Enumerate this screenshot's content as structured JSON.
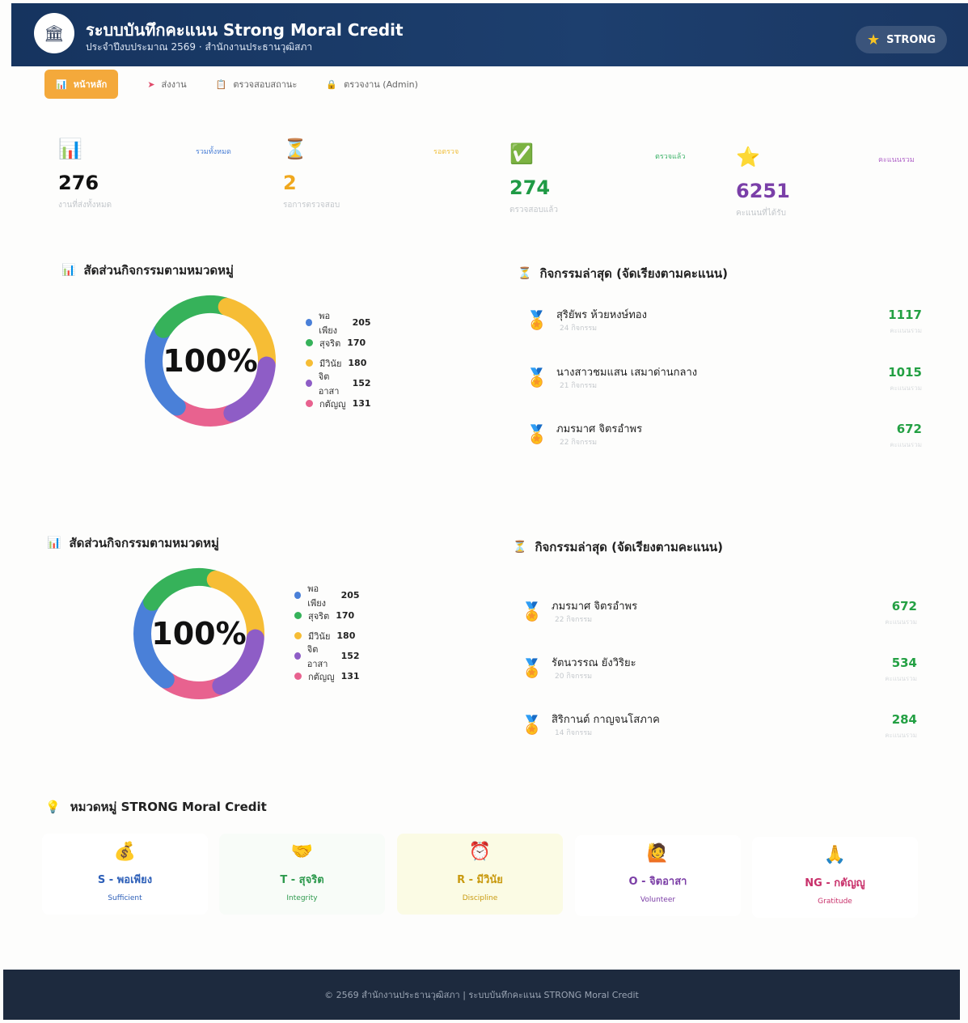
{
  "header": {
    "title": "ระบบบันทึกคะแนน Strong Moral Credit",
    "subtitle": "ประจำปีงบประมาณ 2569 · สำนักงานประธานวุฒิสภา",
    "logo_icon": "building-icon",
    "badge_label": "STRONG"
  },
  "nav": {
    "items": [
      {
        "label": "หน้าหลัก",
        "icon": "chart-icon"
      },
      {
        "label": "ส่งงาน",
        "icon": "send-icon"
      },
      {
        "label": "ตรวจสอบสถานะ",
        "icon": "clipboard-icon"
      },
      {
        "label": "ตรวจงาน (Admin)",
        "icon": "lock-icon"
      }
    ]
  },
  "stats": [
    {
      "icon": "bar-chart-icon",
      "tag": "รวมทั้งหมด",
      "value": "276",
      "label": "งานที่ส่งทั้งหมด",
      "color": "#111111",
      "tag_color": "#4a7fd6"
    },
    {
      "icon": "hourglass-icon",
      "tag": "รอตรวจ",
      "value": "2",
      "label": "รอการตรวจสอบ",
      "color": "#f0a81e",
      "tag_color": "#f0c040"
    },
    {
      "icon": "check-icon",
      "tag": "ตรวจแล้ว",
      "value": "274",
      "label": "ตรวจสอบแล้ว",
      "color": "#1f9a45",
      "tag_color": "#3eb36a"
    },
    {
      "icon": "star-icon",
      "tag": "คะแนนรวม",
      "value": "6251",
      "label": "คะแนนที่ได้รับ",
      "color": "#7a3fa8",
      "tag_color": "#b064c8"
    }
  ],
  "chart_panels": [
    {
      "title": "สัดส่วนกิจกรรมตามหมวดหมู่",
      "center_label": "100%"
    },
    {
      "title": "สัดส่วนกิจกรรมตามหมวดหมู่",
      "center_label": "100%"
    }
  ],
  "chart_data": [
    {
      "type": "pie",
      "categories": [
        "พอเพียง",
        "สุจริต",
        "มีวินัย",
        "จิตอาสา",
        "กตัญญู"
      ],
      "values": [
        205,
        170,
        180,
        152,
        131
      ],
      "colors": [
        "#4a80d8",
        "#36b25a",
        "#f6bd35",
        "#8e5dc6",
        "#e8628f"
      ],
      "title": "สัดส่วนกิจกรรมตามหมวดหมู่"
    },
    {
      "type": "pie",
      "categories": [
        "พอเพียง",
        "สุจริต",
        "มีวินัย",
        "จิตอาสา",
        "กตัญญู"
      ],
      "values": [
        205,
        170,
        180,
        152,
        131
      ],
      "colors": [
        "#4a80d8",
        "#36b25a",
        "#f6bd35",
        "#8e5dc6",
        "#e8628f"
      ],
      "title": "สัดส่วนกิจกรรมตามหมวดหมู่"
    }
  ],
  "ranking_panels": [
    {
      "title": "กิจกรรมล่าสุด (จัดเรียงตามคะแนน)",
      "items": [
        {
          "name": "สุริยัพร ห้วยหงษ์ทอง",
          "count": "24 กิจกรรม",
          "score": "1117",
          "score_label": "คะแนนรวม"
        },
        {
          "name": "นางสาวชมแสน เสมาด่านกลาง",
          "count": "21 กิจกรรม",
          "score": "1015",
          "score_label": "คะแนนรวม"
        },
        {
          "name": "ภมรมาศ จิตรอำพร",
          "count": "22 กิจกรรม",
          "score": "672",
          "score_label": "คะแนนรวม"
        }
      ]
    },
    {
      "title": "กิจกรรมล่าสุด (จัดเรียงตามคะแนน)",
      "items": [
        {
          "name": "ภมรมาศ จิตรอำพร",
          "count": "22 กิจกรรม",
          "score": "672",
          "score_label": "คะแนนรวม"
        },
        {
          "name": "รัตนวรรณ ยังวิริยะ",
          "count": "20 กิจกรรม",
          "score": "534",
          "score_label": "คะแนนรวม"
        },
        {
          "name": "สิริกานต์ กาญจนโสภาค",
          "count": "14 กิจกรรม",
          "score": "284",
          "score_label": "คะแนนรวม"
        }
      ]
    }
  ],
  "categories": {
    "title": "หมวดหมู่ STRONG Moral Credit",
    "items": [
      {
        "name": "S - พอเพียง",
        "en": "Sufficient",
        "icon": "money-bag-icon",
        "color": "#2d5fb8",
        "bg": "#ffffff"
      },
      {
        "name": "T - สุจริต",
        "en": "Integrity",
        "icon": "handshake-icon",
        "color": "#2e9a4e",
        "bg": "#f8fcf8"
      },
      {
        "name": "R - มีวินัย",
        "en": "Discipline",
        "icon": "alarm-clock-icon",
        "color": "#c99a10",
        "bg": "#fbfbe4"
      },
      {
        "name": "O - จิตอาสา",
        "en": "Volunteer",
        "icon": "raised-hand-icon",
        "color": "#7b3ea6",
        "bg": "#ffffff"
      },
      {
        "name": "NG - กตัญญู",
        "en": "Gratitude",
        "icon": "praying-icon",
        "color": "#c8306a",
        "bg": "#ffffff"
      }
    ]
  },
  "footer": {
    "text": "© 2569 สำนักงานประธานวุฒิสภา | ระบบบันทึกคะแนน STRONG Moral Credit"
  }
}
